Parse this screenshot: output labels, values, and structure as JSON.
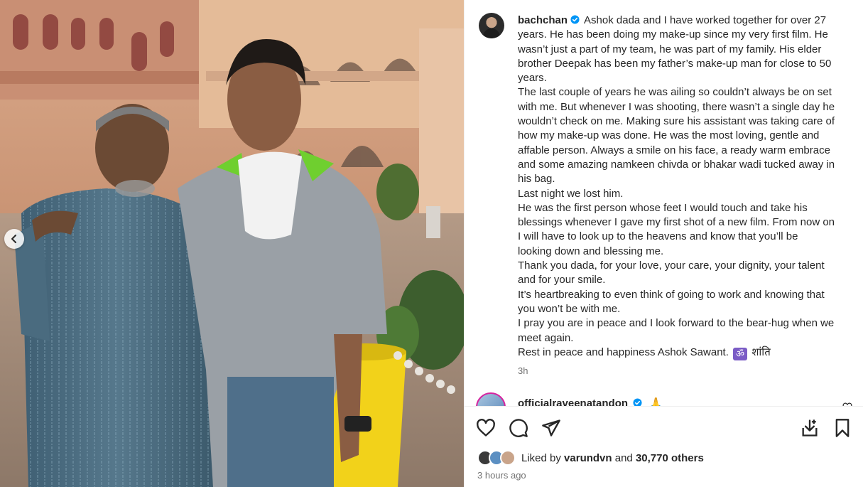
{
  "post": {
    "username": "bachchan",
    "caption_lines": [
      "Ashok dada and I have worked together for over 27",
      "years. He has been doing my make-up since my very first film. He",
      "wasn’t just a part of my team, he was part of my family. His elder",
      "brother Deepak has been my father’s make-up man for close to 50",
      "years.",
      "The last couple of years he was ailing so couldn’t always be on set",
      "with me. But whenever I was shooting, there wasn’t a single day he",
      "wouldn’t check on me. Making sure his assistant was taking care of",
      "how my make-up was done. He was the most loving, gentle and",
      "affable person. Always a smile on his face, a ready warm embrace",
      "and some amazing namkeen chivda or bhakar wadi tucked away in",
      "his bag.",
      "Last night we lost him.",
      "He was the first person whose feet I would touch and take his",
      "blessings whenever I gave my first shot of a new film. From now on",
      "I will have to look up to the heavens and know that you’ll be",
      "looking down and blessing me.",
      "Thank you dada, for your love, your care, your dignity, your talent",
      "and for your smile.",
      "It’s heartbreaking to even think of going to work and knowing that",
      "you won’t be with me.",
      "I pray you are in peace and I look forward to the bear-hug when we",
      "meet again."
    ],
    "closing_line_text": "Rest in peace and happiness Ashok Sawant.",
    "closing_om": "ॐ",
    "closing_shanti": "शांति",
    "caption_age": "3h"
  },
  "comment": {
    "username": "officialraveenatandon",
    "emoji": "🙏"
  },
  "engagement": {
    "liked_by_prefix": "Liked by",
    "liked_by_user": "varundvn",
    "and_word": "and",
    "others_count": "30,770 others",
    "time_ago": "3 hours ago"
  },
  "icons": {
    "like": "heart-icon",
    "comment": "comment-icon",
    "share": "share-icon",
    "save_collection": "save-to-collection-icon",
    "bookmark": "bookmark-icon",
    "carousel_prev": "chevron-left-icon",
    "verified": "verified-badge-icon"
  },
  "colors": {
    "verified": "#0095f6",
    "secondary_text": "#737373",
    "story_ring": "#d6249f"
  }
}
